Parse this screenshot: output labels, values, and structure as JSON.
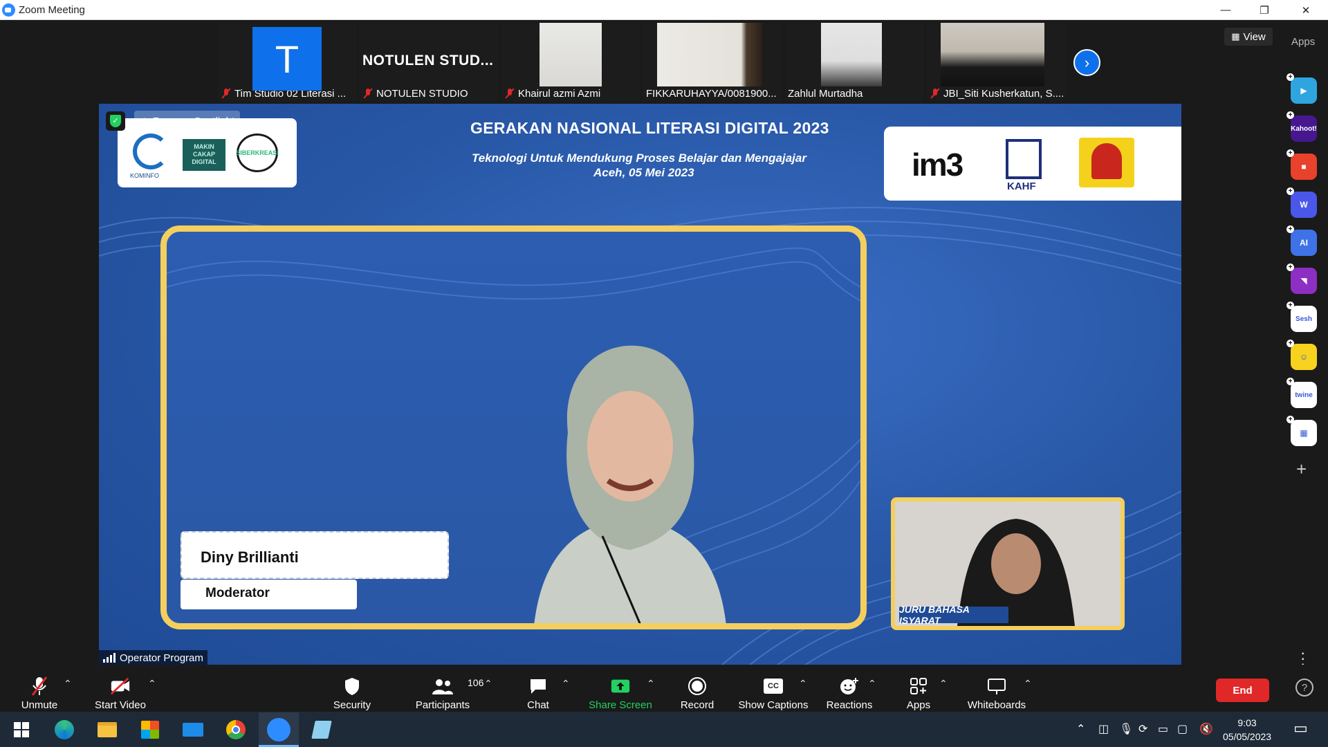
{
  "window": {
    "title": "Zoom Meeting",
    "minimize": "—",
    "restore": "❐",
    "close": "✕"
  },
  "gallery": {
    "participants": [
      {
        "name": "Tim Studio 02 Literasi ...",
        "muted": true,
        "avatar_letter": "T"
      },
      {
        "name": "NOTULEN STUDIO",
        "muted": true,
        "big_label": "NOTULEN  STUD..."
      },
      {
        "name": "Khairul azmi Azmi",
        "muted": true
      },
      {
        "name": "FIKKARUHAYYA/0081900...",
        "muted": false
      },
      {
        "name": "Zahlul Murtadha",
        "muted": false
      },
      {
        "name": "JBI_Siti Kusherkatun, S....",
        "muted": true
      }
    ],
    "next_arrow": "›",
    "view_label": "View",
    "apps_label": "Apps"
  },
  "slide": {
    "title": "GERAKAN NASIONAL LITERASI DIGITAL 2023",
    "subtitle_line1": "Teknologi Untuk Mendukung Proses Belajar dan Mengajajar",
    "subtitle_line2": "Aceh, 05 Mei 2023",
    "left_logos": [
      "KOMINFO",
      "MAKIN CAKAP DIGITAL",
      "SIBERKREASI"
    ],
    "right_logos": [
      "im3",
      "KAHF"
    ],
    "speaker_name": "Diny Brillianti",
    "speaker_role": "Moderator",
    "interpreter_label": "JURU BAHASA ISYARAT"
  },
  "spotlight": {
    "remove_label": "Remove Spotlight",
    "operator_label": "Operator Program"
  },
  "toolbar": {
    "unmute": "Unmute",
    "start_video": "Start Video",
    "security": "Security",
    "participants": "Participants",
    "participants_count": "106",
    "chat": "Chat",
    "share_screen": "Share Screen",
    "record": "Record",
    "show_captions": "Show Captions",
    "cc": "CC",
    "reactions": "Reactions",
    "apps": "Apps",
    "whiteboards": "Whiteboards",
    "end": "End",
    "help": "?"
  },
  "rail_apps": [
    {
      "name": "Slido-like app",
      "label": "▶",
      "color": "#2fa5e0"
    },
    {
      "name": "Kahoot!",
      "label": "Kahoot!",
      "color": "#46178f"
    },
    {
      "name": "Red app",
      "label": "■",
      "color": "#e8412c"
    },
    {
      "name": "Wooclap",
      "label": "W",
      "color": "#4a57e8"
    },
    {
      "name": "AI app",
      "label": "AI",
      "color": "#3f72e6"
    },
    {
      "name": "Video app",
      "label": "◥",
      "color": "#8c2fc2"
    },
    {
      "name": "Sesh",
      "label": "Sesh",
      "color": "#ffffff"
    },
    {
      "name": "Emoji app",
      "label": "☺",
      "color": "#f7d21e"
    },
    {
      "name": "Twine",
      "label": "twine",
      "color": "#ffffff"
    },
    {
      "name": "Grid app",
      "label": "▦",
      "color": "#ffffff"
    }
  ],
  "taskbar": {
    "time": "9:03",
    "date": "05/05/2023"
  },
  "colors": {
    "accent": "#0e71eb",
    "share_green": "#23d160",
    "end_red": "#e02828",
    "frame_gold": "#f4cf5d",
    "slide_blue": "#2a5aa8"
  }
}
